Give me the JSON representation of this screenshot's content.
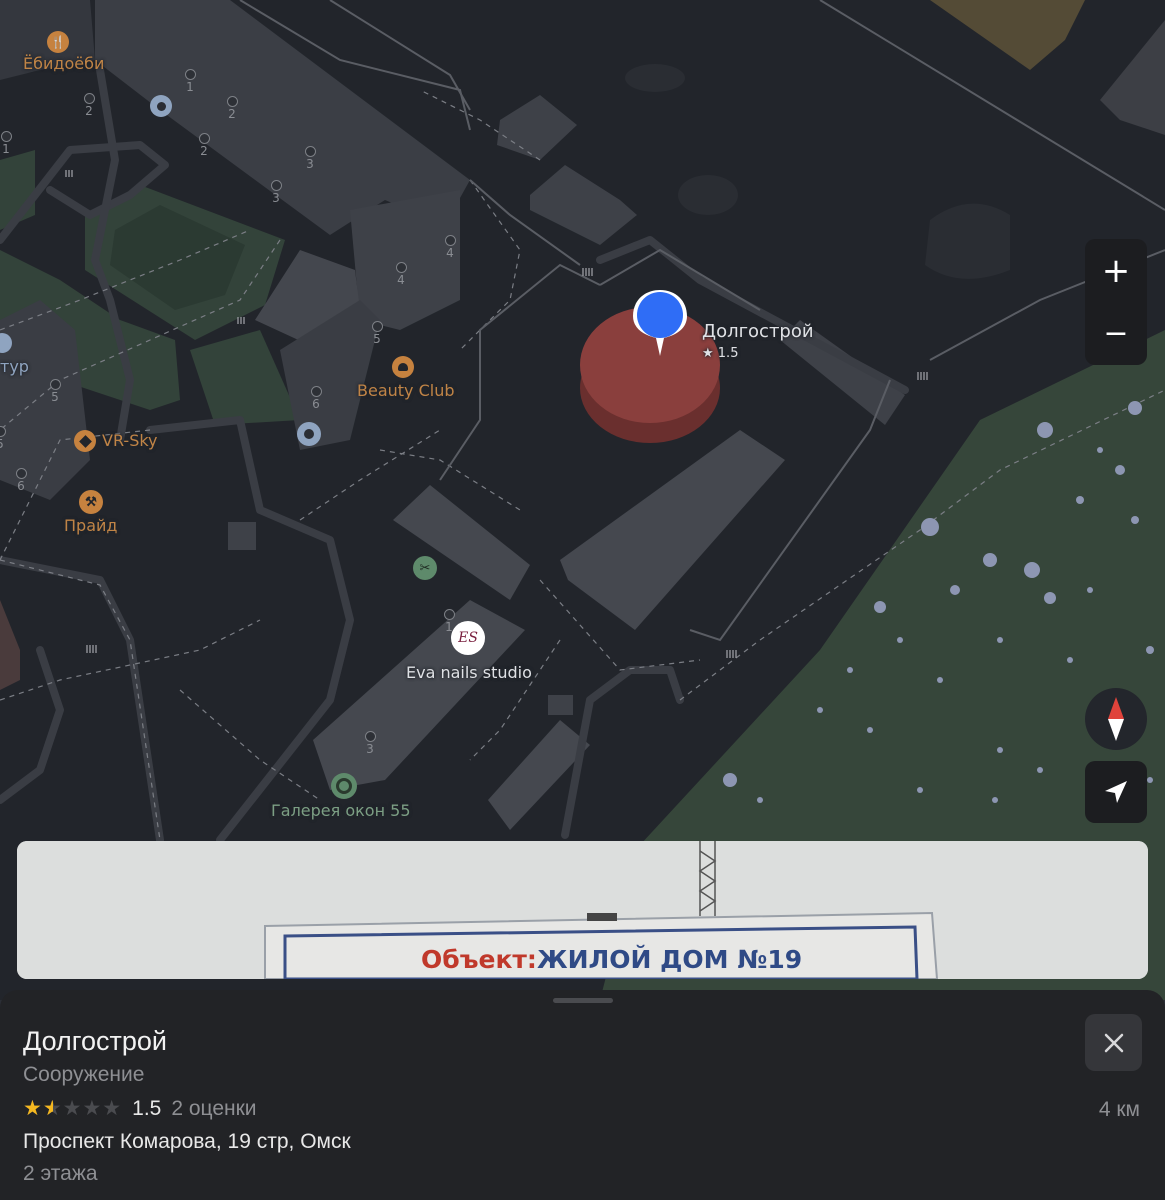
{
  "map": {
    "pois": [
      {
        "key": "ebidoebi",
        "label": "Ёбидоёби",
        "icon": "restaurant-icon"
      },
      {
        "key": "beauty",
        "label": "Beauty Club",
        "icon": "beauty-salon-icon"
      },
      {
        "key": "vrsky",
        "label": "VR-Sky",
        "icon": "entertainment-icon"
      },
      {
        "key": "praid",
        "label": "Прайд",
        "icon": "fitness-icon"
      },
      {
        "key": "eva",
        "label": "Eva nails studio",
        "icon": "nails-studio-logo"
      },
      {
        "key": "galereya",
        "label": "Галерея окон 55",
        "icon": "shop-icon"
      },
      {
        "key": "tur",
        "label": "тур",
        "icon": "travel-icon"
      }
    ],
    "selected_pin": {
      "name": "Долгострой",
      "rating": "★ 1.5",
      "icon": "location-pin-icon"
    },
    "house_numbers": [
      "1",
      "2",
      "2",
      "2",
      "1",
      "3",
      "3",
      "4",
      "4",
      "5",
      "6",
      "5",
      "6",
      "1",
      "3",
      "5"
    ],
    "controls": {
      "zoom_in": "+",
      "zoom_out": "−",
      "compass": "compass-icon",
      "locate": "my-location-icon"
    }
  },
  "photo": {
    "sign_prefix": "Объект:",
    "sign_text": "ЖИЛОЙ ДОМ №19"
  },
  "place": {
    "title": "Долгострой",
    "category": "Сооружение",
    "rating_value": "1.5",
    "rating_fraction": 0.3,
    "reviews": "2 оценки",
    "distance": "4 км",
    "address": "Проспект Комарова, 19 стр, Омск",
    "floors": "2 этажа",
    "close": "close-icon"
  },
  "colors": {
    "pin": "#2f6df6",
    "building_highlight": "#8a3f3d",
    "star": "#f5b820",
    "forest": "#36463a"
  }
}
